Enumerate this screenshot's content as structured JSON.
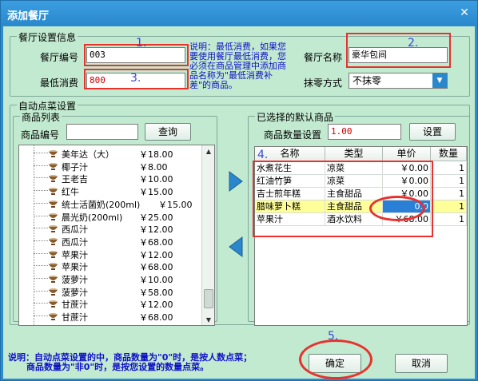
{
  "window": {
    "title": "添加餐厅",
    "close_label": "✕"
  },
  "restaurant_settings": {
    "group_label": "餐厅设置信息",
    "id_label": "餐厅编号",
    "id_value": "003",
    "name_label": "餐厅名称",
    "name_value": "豪华包间",
    "min_spend_label": "最低消费",
    "min_spend_value": "800",
    "rounding_label": "抹零方式",
    "rounding_value": "不抹零",
    "note": "说明：最低消费，如果您\n要使用餐厅最低消费，您\n必须在商品管理中添加商\n品名称为\"最低消费补\n差\"的商品。"
  },
  "auto_order": {
    "group_label": "自动点菜设置",
    "product_list": {
      "group_label": "商品列表",
      "search_label": "商品编号",
      "search_value": "",
      "search_button": "查询",
      "items": [
        {
          "name": "美年达（大）",
          "price": "￥18.00"
        },
        {
          "name": "椰子汁",
          "price": "￥8.00"
        },
        {
          "name": "王老吉",
          "price": "￥10.00"
        },
        {
          "name": "红牛",
          "price": "￥15.00"
        },
        {
          "name": "统士活菌奶(200ml)",
          "price": "￥15.00"
        },
        {
          "name": "晨光奶(200ml)",
          "price": "￥25.00"
        },
        {
          "name": "西瓜汁",
          "price": "￥12.00"
        },
        {
          "name": "西瓜汁",
          "price": "￥68.00"
        },
        {
          "name": "苹果汁",
          "price": "￥12.00"
        },
        {
          "name": "苹果汁",
          "price": "￥68.00"
        },
        {
          "name": "菠萝汁",
          "price": "￥10.00"
        },
        {
          "name": "菠萝汁",
          "price": "￥58.00"
        },
        {
          "name": "甘蔗汁",
          "price": "￥12.00"
        },
        {
          "name": "甘蔗汁",
          "price": "￥68.00"
        }
      ]
    },
    "selected": {
      "group_label": "已选择的默认商品",
      "qty_label": "商品数量设置",
      "qty_value": "1.00",
      "set_button": "设置",
      "columns": [
        "名称",
        "类型",
        "单价",
        "数量"
      ],
      "rows": [
        {
          "name": "水煮花生",
          "type": "凉菜",
          "price": "￥0.00",
          "qty": "1"
        },
        {
          "name": "红油竹笋",
          "type": "凉菜",
          "price": "￥0.00",
          "qty": "1"
        },
        {
          "name": "吉士煎年糕",
          "type": "主食甜品",
          "price": "￥0.00",
          "qty": "1"
        },
        {
          "name": "腊味萝卜糕",
          "type": "主食甜品",
          "price": "0.0",
          "qty": "1"
        },
        {
          "name": "苹果汁",
          "type": "酒水饮料",
          "price": "￥68.00",
          "qty": "1"
        }
      ]
    }
  },
  "footer": {
    "note": "说明：自动点菜设置的中，商品数量为\"0\"时，是按人数点菜；\n      商品数量为\"非0\"时，是按您设置的数量点菜。",
    "ok_button": "确定",
    "cancel_button": "取消"
  },
  "annotations": [
    "1.",
    "2.",
    "3.",
    "4.",
    "5."
  ],
  "colors": {
    "title_bar": "#2a87cc",
    "client_bg": "#c2ead0",
    "mark_red": "#e8322e",
    "note_blue": "#1010c8",
    "highlight_row": "#ffff99"
  }
}
